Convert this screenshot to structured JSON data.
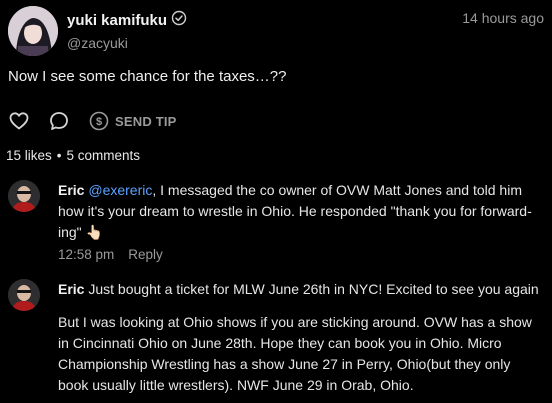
{
  "post": {
    "author_name": "yuki kamifuku",
    "author_handle": "@zacyuki",
    "time": "14 hours ago",
    "text": "Now I see some chance for the taxes…??",
    "send_tip_label": "SEND TIP",
    "likes": "15 likes",
    "comments": "5 comments"
  },
  "comments": [
    {
      "name": "Eric",
      "mention": "@exereric",
      "text": ", I messaged the co owner of OVW Matt Jones and told him how it's your dream to wrestle in Ohio. He responded \"thank you for forward-ing\" ",
      "emoji": "👆🏻",
      "time": "12:58 pm",
      "reply_label": "Reply"
    },
    {
      "name": "Eric",
      "text": " Just bought a ticket for MLW June 26th in NYC! Excited to see you again",
      "text2": "But I was looking at Ohio shows if you are sticking around. OVW has a show in Cincinnati Ohio on June 28th. Hope they can book you in Ohio. Micro Championship Wrestling has a show June 27 in Perry, Ohio(but they only book usually little wrestlers). NWF June 29 in Orab, Ohio."
    }
  ],
  "colors": {
    "background": "#000000",
    "mention": "#5aa2ff",
    "muted": "#9a9a9a"
  },
  "icons": [
    "verified-icon",
    "heart-icon",
    "comment-icon",
    "dollar-icon"
  ]
}
